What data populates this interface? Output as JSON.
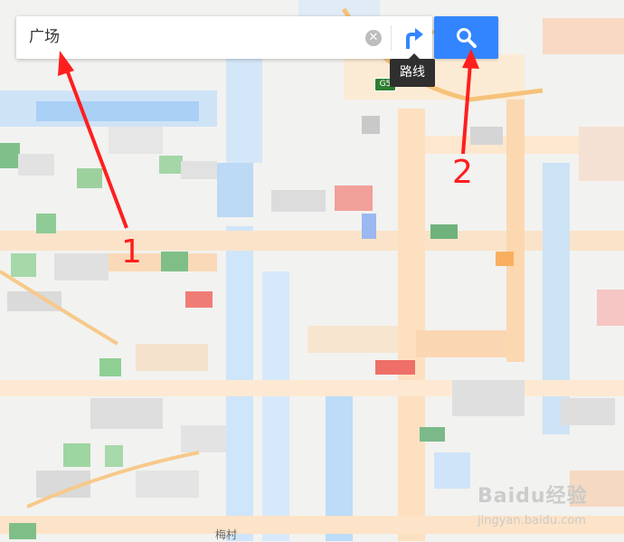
{
  "search": {
    "value": "广场",
    "clear_icon": "close-circle-icon",
    "route_icon": "route-arrow-icon",
    "search_icon": "search-icon"
  },
  "tooltip": {
    "text": "路线"
  },
  "annotations": {
    "one": "1",
    "two": "2"
  },
  "map": {
    "highway_shield": "G5",
    "labels": {
      "bottom_place": "梅村"
    }
  },
  "watermark": {
    "brand": "Baidu经验",
    "sub": "jingyan.baidu.com"
  },
  "colors": {
    "accent": "#3385ff",
    "annotation": "#ff1e1e"
  }
}
